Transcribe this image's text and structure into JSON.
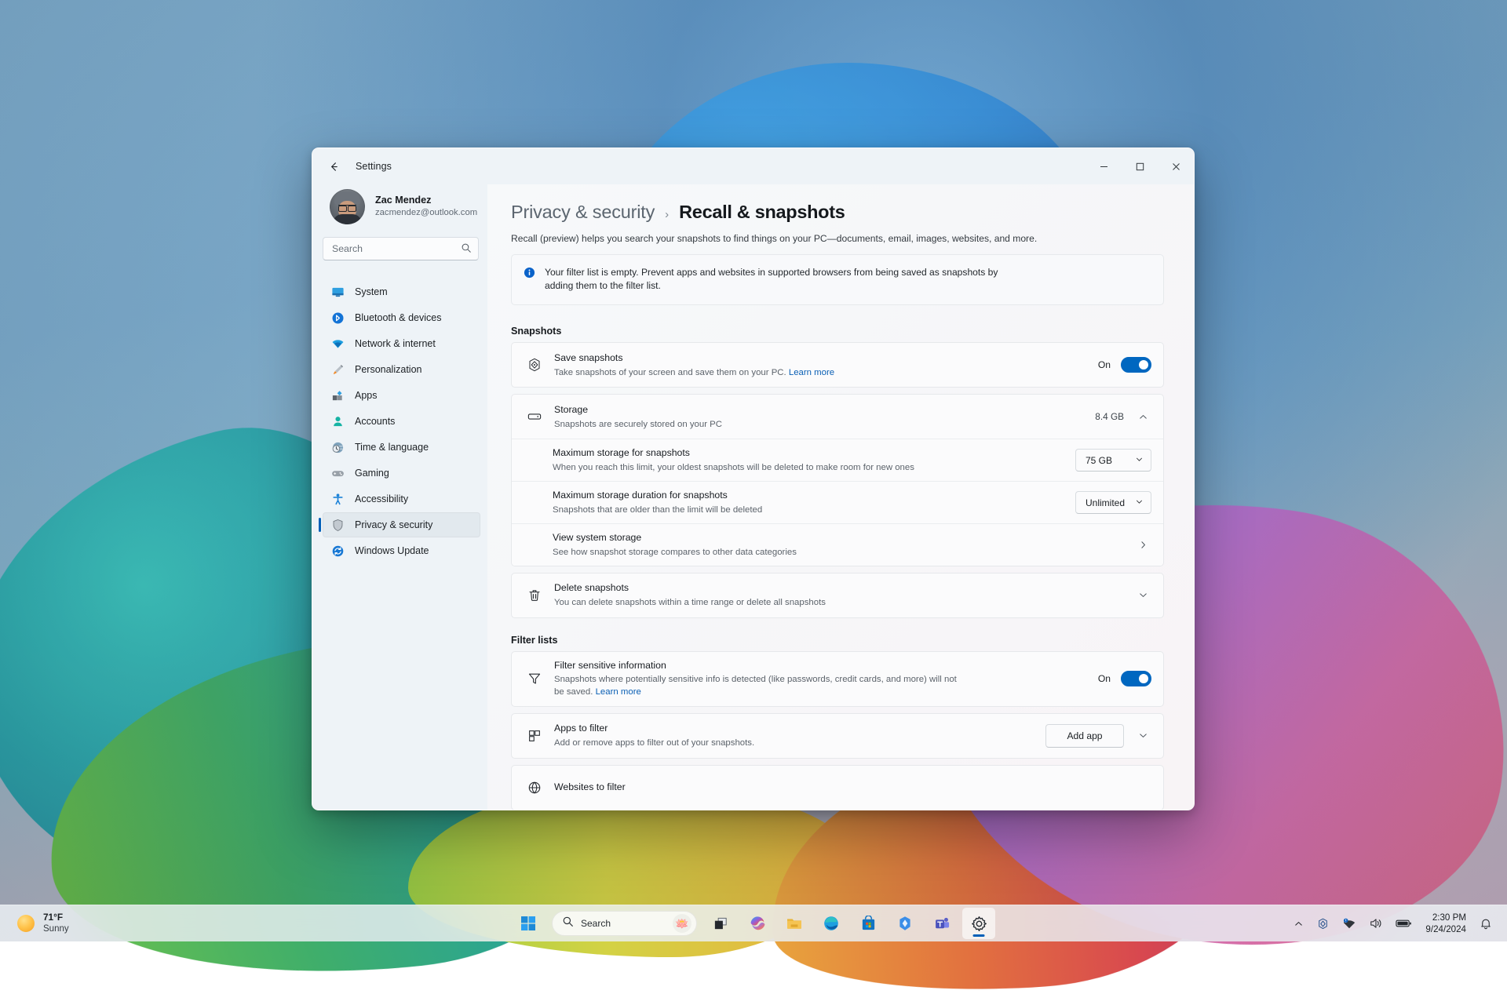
{
  "window": {
    "title": "Settings",
    "back_icon": "arrow-left-icon",
    "minimize_label": "–",
    "maximize_label": "□",
    "close_label": "✕"
  },
  "sidebar": {
    "account": {
      "name": "Zac Mendez",
      "email": "zacmendez@outlook.com"
    },
    "search": {
      "placeholder": "Search",
      "value": "",
      "icon": "search-icon"
    },
    "items": [
      {
        "label": "System",
        "icon": "system-icon",
        "active": false
      },
      {
        "label": "Bluetooth & devices",
        "icon": "bluetooth-icon",
        "active": false
      },
      {
        "label": "Network & internet",
        "icon": "wifi-icon",
        "active": false
      },
      {
        "label": "Personalization",
        "icon": "paintbrush-icon",
        "active": false
      },
      {
        "label": "Apps",
        "icon": "apps-icon",
        "active": false
      },
      {
        "label": "Accounts",
        "icon": "person-icon",
        "active": false
      },
      {
        "label": "Time & language",
        "icon": "clock-globe-icon",
        "active": false
      },
      {
        "label": "Gaming",
        "icon": "gamepad-icon",
        "active": false
      },
      {
        "label": "Accessibility",
        "icon": "accessibility-icon",
        "active": false
      },
      {
        "label": "Privacy & security",
        "icon": "shield-icon",
        "active": true
      },
      {
        "label": "Windows Update",
        "icon": "update-icon",
        "active": false
      }
    ]
  },
  "main": {
    "breadcrumb": {
      "parent": "Privacy & security",
      "separator": "›",
      "current": "Recall & snapshots"
    },
    "description": "Recall (preview) helps you search your snapshots to find things on your PC—documents, email, images, websites, and more.",
    "info_banner": {
      "icon": "info-icon",
      "text": "Your filter list is empty. Prevent apps and websites in supported browsers from being saved as snapshots by adding them to the filter list."
    },
    "sections": [
      {
        "heading": "Snapshots",
        "rows": [
          {
            "name": "save-snapshots",
            "icon": "snapshot-icon",
            "title": "Save snapshots",
            "subtitle": "Take snapshots of your screen and save them on your PC.",
            "link": "Learn more",
            "control": "toggle",
            "toggle_state": "On"
          },
          {
            "name": "storage",
            "icon": "storage-icon",
            "title": "Storage",
            "subtitle": "Snapshots are securely stored on your PC",
            "control": "value-chevron",
            "value": "8.4 GB",
            "chevron": "chevron-up-icon",
            "expanded": true,
            "children": [
              {
                "name": "maximum-storage",
                "title": "Maximum storage for snapshots",
                "subtitle": "When you reach this limit, your oldest snapshots will be deleted to make room for new ones",
                "control": "dropdown",
                "value": "75 GB"
              },
              {
                "name": "maximum-duration",
                "title": "Maximum storage duration for snapshots",
                "subtitle": "Snapshots that are older than the limit will be deleted",
                "control": "dropdown",
                "value": "Unlimited"
              },
              {
                "name": "view-system-storage",
                "title": "View system storage",
                "subtitle": "See how snapshot storage compares to other data categories",
                "control": "navigate",
                "chevron": "chevron-right-icon"
              }
            ]
          },
          {
            "name": "delete-snapshots",
            "icon": "trash-icon",
            "title": "Delete snapshots",
            "subtitle": "You can delete snapshots within a time range or delete all snapshots",
            "control": "expand",
            "chevron": "chevron-down-icon"
          }
        ]
      },
      {
        "heading": "Filter lists",
        "rows": [
          {
            "name": "filter-sensitive-information",
            "icon": "funnel-icon",
            "title": "Filter sensitive information",
            "subtitle": "Snapshots where potentially sensitive info is detected (like passwords, credit cards, and more) will not be saved.",
            "link": "Learn more",
            "control": "toggle",
            "toggle_state": "On"
          },
          {
            "name": "apps-to-filter",
            "icon": "grid-apps-icon",
            "title": "Apps to filter",
            "subtitle": "Add or remove apps to filter out of your snapshots.",
            "control": "button-expand",
            "button_label": "Add app",
            "chevron": "chevron-down-icon"
          },
          {
            "name": "websites-to-filter",
            "icon": "globe-icon",
            "title": "Websites to filter",
            "subtitle": "",
            "control": "button-expand",
            "button_label": "",
            "chevron": "chevron-down-icon"
          }
        ]
      }
    ]
  },
  "taskbar": {
    "weather": {
      "temperature": "71°F",
      "condition": "Sunny",
      "icon": "sun-icon"
    },
    "start_icon": "windows-start-icon",
    "search": {
      "placeholder": "Search",
      "icon": "search-icon",
      "companion_icon": "lotus-icon",
      "companion_glyph": "🪷"
    },
    "apps": [
      {
        "name": "task-view",
        "icon": "task-view-icon"
      },
      {
        "name": "copilot",
        "icon": "copilot-icon"
      },
      {
        "name": "file-explorer",
        "icon": "folder-icon"
      },
      {
        "name": "microsoft-edge",
        "icon": "edge-icon"
      },
      {
        "name": "microsoft-store",
        "icon": "store-icon"
      },
      {
        "name": "recall",
        "icon": "recall-sparkle-icon"
      },
      {
        "name": "microsoft-teams",
        "icon": "teams-icon"
      },
      {
        "name": "settings",
        "icon": "gear-icon",
        "active": true
      }
    ],
    "tray": {
      "chevron_icon": "chevron-up-icon",
      "recall_icon": "recall-icon",
      "network_icon": "wifi-icon",
      "volume_icon": "speaker-icon",
      "battery_icon": "battery-icon",
      "time": "2:30 PM",
      "date": "9/24/2024",
      "notification_icon": "bell-icon"
    }
  },
  "colors": {
    "accent": "#0067c0",
    "accent_dark": "#005fb8",
    "link": "#0a5fb4"
  }
}
